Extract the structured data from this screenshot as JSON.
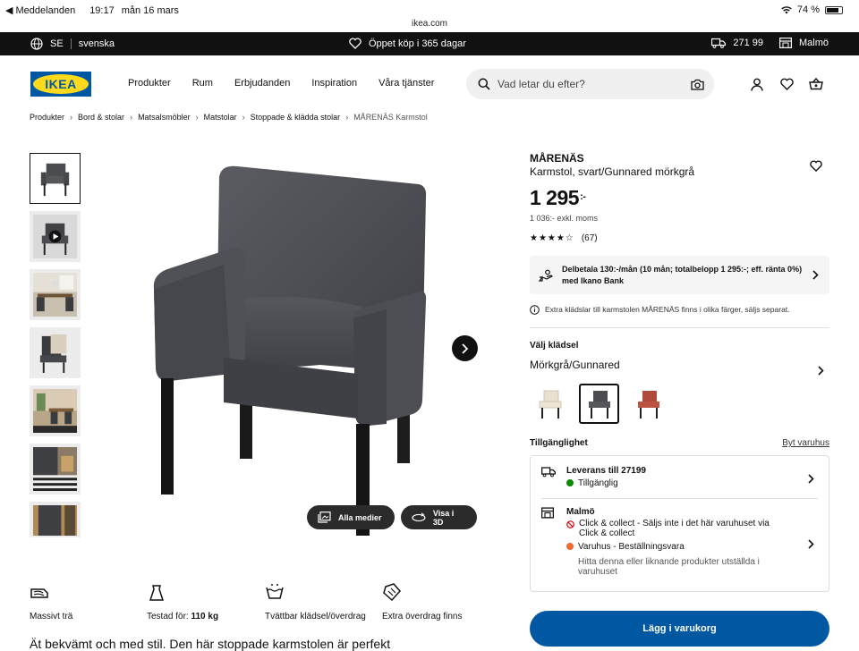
{
  "status_bar": {
    "back_app": "◀ Meddelanden",
    "time": "19:17",
    "date": "mån 16 mars",
    "url": "ikea.com",
    "battery": "74 %"
  },
  "top_bar": {
    "country": "SE",
    "language": "svenska",
    "hours": "Öppet köp i 365 dagar",
    "postcode": "271 99",
    "store": "Malmö"
  },
  "header": {
    "logo_text": "IKEA",
    "nav": [
      "Produkter",
      "Rum",
      "Erbjudanden",
      "Inspiration",
      "Våra tjänster"
    ],
    "search_placeholder": "Vad letar du efter?"
  },
  "breadcrumb": [
    "Produkter",
    "Bord & stolar",
    "Matsalsmöbler",
    "Matstolar",
    "Stoppade & klädda stolar",
    "MÅRENÄS Karmstol"
  ],
  "media_buttons": {
    "all_media": "Alla medier",
    "view_3d": "Visa i 3D"
  },
  "features": [
    {
      "icon": "wood-icon",
      "label": "Massivt trä"
    },
    {
      "icon": "weight-icon",
      "label_prefix": "Testad för: ",
      "label_bold": "110 kg"
    },
    {
      "icon": "washable-icon",
      "label": "Tvättbar klädsel/överdrag"
    },
    {
      "icon": "cover-icon",
      "label": "Extra överdrag finns"
    }
  ],
  "teaser": "Ät bekvämt och med stil. Den här stoppade karmstolen är perfekt",
  "product": {
    "name": "MÅRENÄS",
    "description": "Karmstol, svart/Gunnared mörkgrå",
    "price_int": "1 295",
    "price_dec": ":-",
    "ex_vat": "1 036:- exkl. moms",
    "rating_stars": 4,
    "rating_count": "(67)",
    "finance": "Delbetala 130:-/mån (10 mån; totalbelopp 1 295:-; eff. ränta 0%) med Ikano Bank",
    "info": "Extra klädslar till karmstolen MÅRENÄS finns i olika färger, säljs separat.",
    "color_title": "Välj klädsel",
    "color_value": "Mörkgrå/Gunnared",
    "swatches": [
      {
        "name": "beige",
        "color": "#e8e0d0"
      },
      {
        "name": "dark-grey",
        "color": "#4a4c50",
        "selected": true
      },
      {
        "name": "red",
        "color": "#b04a3a"
      }
    ]
  },
  "availability": {
    "title": "Tillgänglighet",
    "change_store": "Byt varuhus",
    "delivery_title": "Leverans till 27199",
    "delivery_status": "Tillgänglig",
    "store_title": "Malmö",
    "click_collect": "Click & collect - Säljs inte i det här varuhuset via Click & collect",
    "warehouse": "Varuhus - Beställningsvara",
    "similar": "Hitta denna eller liknande produkter utställda i varuhuset",
    "colors": {
      "green": "#0a8a00",
      "red": "#cc0008",
      "orange": "#f26a2e"
    }
  },
  "cart_button": "Lägg i varukorg",
  "colors": {
    "ikea_blue": "#0058a3",
    "ikea_yellow": "#ffda1a"
  }
}
